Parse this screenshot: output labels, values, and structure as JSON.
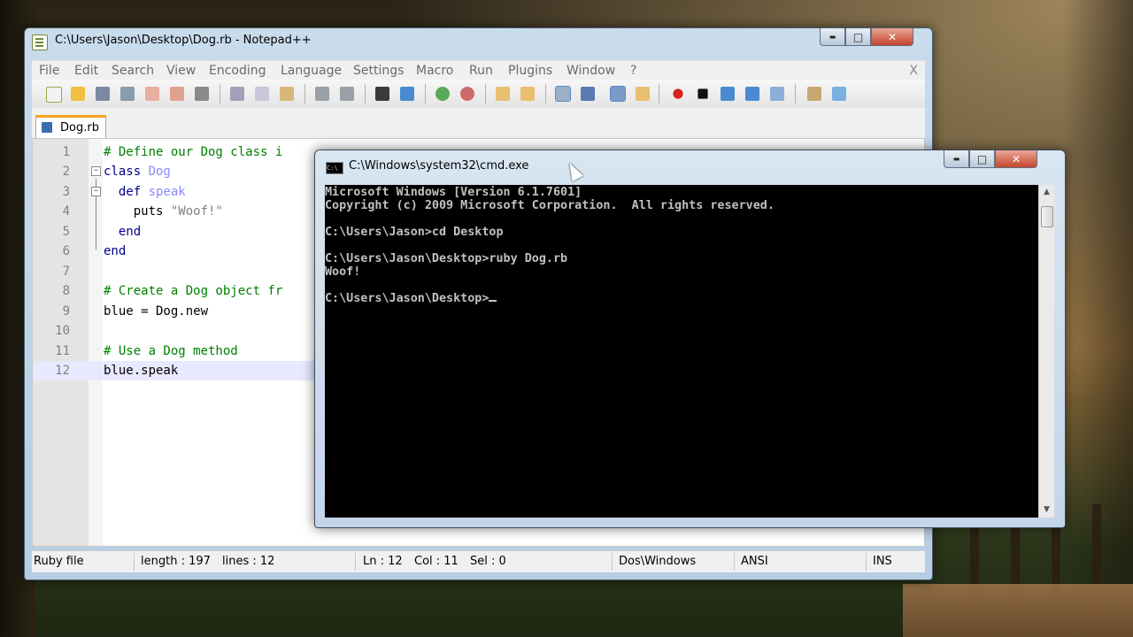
{
  "npp": {
    "title": "C:\\Users\\Jason\\Desktop\\Dog.rb - Notepad++",
    "menu": [
      "File",
      "Edit",
      "Search",
      "View",
      "Encoding",
      "Language",
      "Settings",
      "Macro",
      "Run",
      "Plugins",
      "Window",
      "?"
    ],
    "menu_close": "X",
    "caption": {
      "min": "▬",
      "max": "□",
      "close": "✕"
    },
    "tab_label": "Dog.rb",
    "code_lines": [
      {
        "n": "1",
        "text": "# Define our Dog class i"
      },
      {
        "n": "2",
        "text": "class Dog"
      },
      {
        "n": "3",
        "text": "  def speak"
      },
      {
        "n": "4",
        "text": "    puts \"Woof!\""
      },
      {
        "n": "5",
        "text": "  end"
      },
      {
        "n": "6",
        "text": "end"
      },
      {
        "n": "7",
        "text": ""
      },
      {
        "n": "8",
        "text": "# Create a Dog object fr"
      },
      {
        "n": "9",
        "text": "blue = Dog.new"
      },
      {
        "n": "10",
        "text": ""
      },
      {
        "n": "11",
        "text": "# Use a Dog method"
      },
      {
        "n": "12",
        "text": "blue.speak"
      }
    ],
    "status": {
      "type": "Ruby file",
      "length": "length : 197",
      "lines": "lines : 12",
      "ln": "Ln : 12",
      "col": "Col : 11",
      "sel": "Sel : 0",
      "eol": "Dos\\Windows",
      "encoding": "ANSI",
      "mode": "INS"
    }
  },
  "cmd": {
    "title": "C:\\Windows\\system32\\cmd.exe",
    "icon_text": "C:\\",
    "caption": {
      "min": "▬",
      "max": "□",
      "close": "✕"
    },
    "lines": [
      "Microsoft Windows [Version 6.1.7601]",
      "Copyright (c) 2009 Microsoft Corporation.  All rights reserved.",
      "",
      "C:\\Users\\Jason>cd Desktop",
      "",
      "C:\\Users\\Jason\\Desktop>ruby Dog.rb",
      "Woof!",
      "",
      "C:\\Users\\Jason\\Desktop>"
    ],
    "scroll_up": "▲",
    "scroll_down": "▼"
  }
}
